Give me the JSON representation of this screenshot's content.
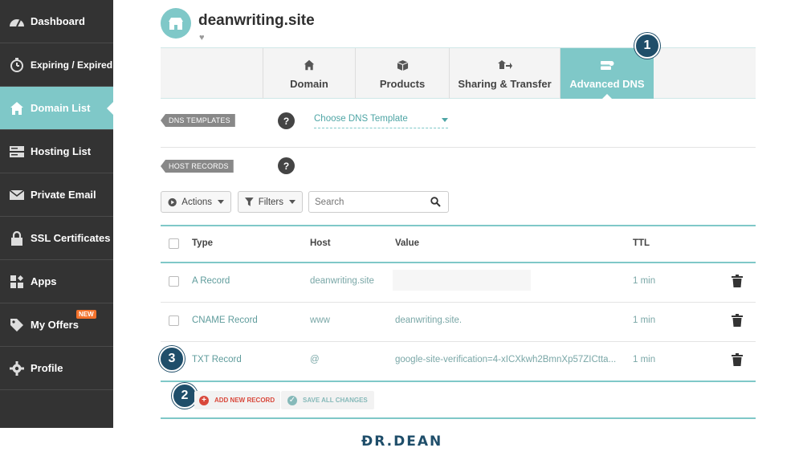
{
  "sidebar": {
    "items": [
      {
        "label": "Dashboard",
        "icon": "speedometer-icon"
      },
      {
        "label": "Expiring / Expired",
        "icon": "timer-icon"
      },
      {
        "label": "Domain List",
        "icon": "home-icon",
        "active": true
      },
      {
        "label": "Hosting List",
        "icon": "server-icon"
      },
      {
        "label": "Private Email",
        "icon": "envelope-icon"
      },
      {
        "label": "SSL Certificates",
        "icon": "lock-icon"
      },
      {
        "label": "Apps",
        "icon": "apps-icon"
      },
      {
        "label": "My Offers",
        "icon": "tag-icon",
        "badge": "NEW"
      },
      {
        "label": "Profile",
        "icon": "gear-icon"
      }
    ]
  },
  "header": {
    "site_name": "deanwriting.site",
    "heart_icon": "heart-icon"
  },
  "tabs": [
    {
      "label": "Domain",
      "icon": "home-icon"
    },
    {
      "label": "Products",
      "icon": "box-icon"
    },
    {
      "label": "Sharing & Transfer",
      "icon": "share-icon"
    },
    {
      "label": "Advanced DNS",
      "icon": "dns-icon",
      "active": true
    }
  ],
  "steps": {
    "one": "1",
    "two": "2",
    "three": "3"
  },
  "dns_templates": {
    "label": "DNS TEMPLATES",
    "help": "?",
    "select_value": "Choose DNS Template"
  },
  "host_records": {
    "label": "HOST RECORDS",
    "help": "?"
  },
  "controls": {
    "actions_label": "Actions",
    "filters_label": "Filters",
    "search_placeholder": "Search"
  },
  "table": {
    "headers": {
      "type": "Type",
      "host": "Host",
      "value": "Value",
      "ttl": "TTL"
    },
    "rows": [
      {
        "type": "A Record",
        "host": "deanwriting.site",
        "value": "",
        "ttl": "1 min"
      },
      {
        "type": "CNAME Record",
        "host": "www",
        "value": "deanwriting.site.",
        "ttl": "1 min"
      },
      {
        "type": "TXT Record",
        "host": "@",
        "value": "google-site-verification=4-xICXkwh2BmnXp57ZICtta...",
        "ttl": "1 min"
      }
    ]
  },
  "footer_actions": {
    "add_label": "ADD NEW RECORD",
    "save_label": "SAVE ALL CHANGES"
  },
  "brand": "ÐR.DEAN",
  "colors": {
    "sidebar_bg": "#333333",
    "accent": "#7fc8c8",
    "step_badge": "#1f4e6a",
    "add_red": "#d9483b",
    "new_badge": "#f3722c"
  }
}
